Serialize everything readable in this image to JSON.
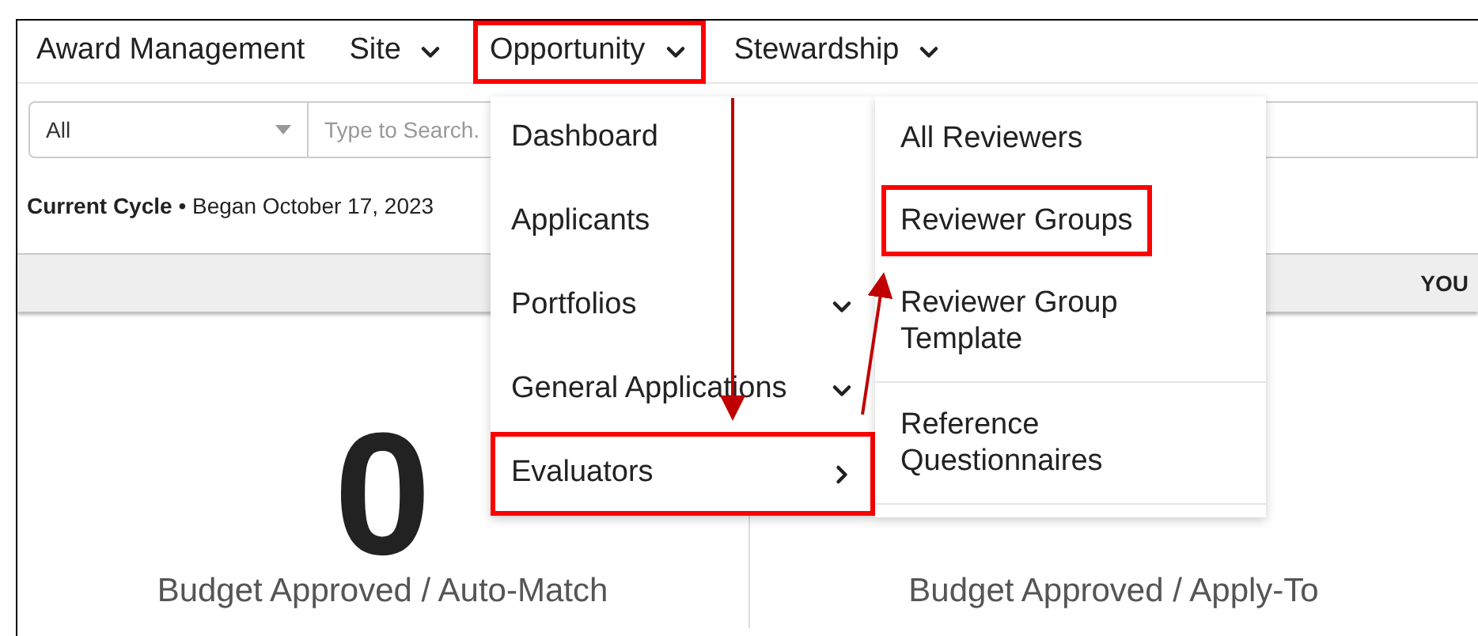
{
  "nav": {
    "brand": "Award Management",
    "items": [
      {
        "label": "Site",
        "highlighted": false
      },
      {
        "label": "Opportunity",
        "highlighted": true
      },
      {
        "label": "Stewardship",
        "highlighted": false
      }
    ]
  },
  "filter": {
    "select": "All",
    "search_placeholder": "Type to Search."
  },
  "cycle": "**Current Cycle** • Began October 17, 2023",
  "band": "YOU",
  "cards": [
    {
      "value": "0",
      "label": "Budget Approved / Auto-Match"
    },
    {
      "label": "Budget Approved / Apply-To"
    }
  ],
  "menu": [
    {
      "label": "Dashboard",
      "kind": "plain",
      "highlighted": false
    },
    {
      "label": "Applicants",
      "kind": "plain",
      "highlighted": false
    },
    {
      "label": "Portfolios",
      "kind": "dropdown",
      "highlighted": false
    },
    {
      "label": "General Applications",
      "kind": "dropdown",
      "highlighted": false
    },
    {
      "label": "Evaluators",
      "kind": "submenu",
      "highlighted": true
    }
  ],
  "submenu": [
    {
      "label": "All Reviewers",
      "highlighted": false
    },
    {
      "label": "Reviewer Groups",
      "highlighted": true
    },
    {
      "label": "Reviewer Group Template",
      "highlighted": false
    },
    {
      "label": "Reference Questionnaires",
      "highlighted": false
    }
  ]
}
